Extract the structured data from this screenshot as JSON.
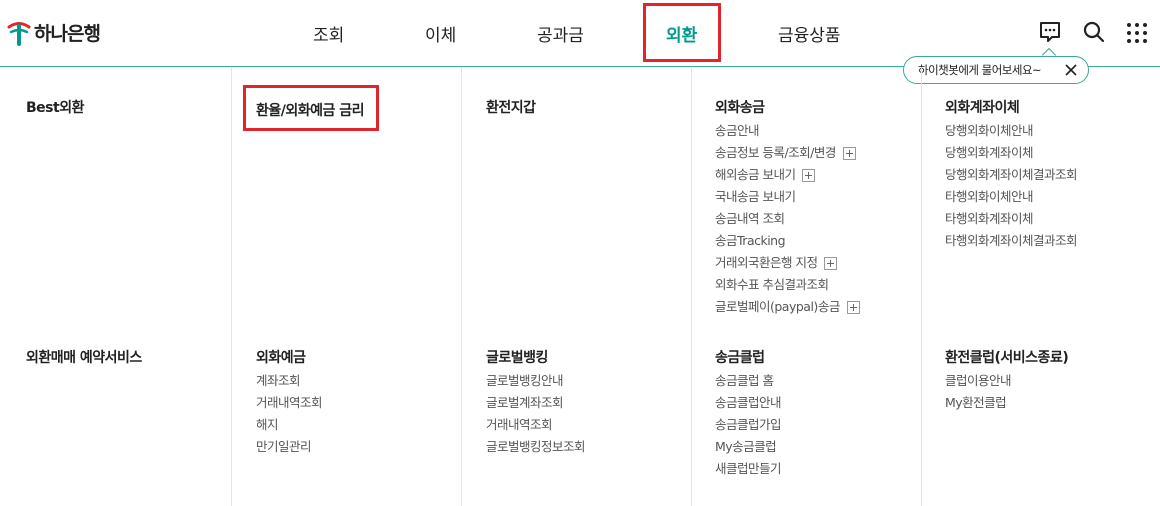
{
  "brand": {
    "name": "하나은행",
    "primary_color": "#009b8e",
    "highlight_color": "#e0262b"
  },
  "gnb": {
    "items": [
      {
        "label": "조회"
      },
      {
        "label": "이체"
      },
      {
        "label": "공과금"
      },
      {
        "label": "외환",
        "active": true
      },
      {
        "label": "금융상품"
      }
    ]
  },
  "utility": {
    "chatbot_icon": "chat-bubble-icon",
    "search_icon": "search-icon",
    "menu_icon": "grid-menu-icon"
  },
  "tooltip": {
    "text": "하이챗봇에게 물어보세요~",
    "close_icon": "close-icon"
  },
  "menu": {
    "row1": [
      {
        "title": "Best외환",
        "items": []
      },
      {
        "title": "환율/외화예금 금리",
        "items": []
      },
      {
        "title": "환전지갑",
        "items": []
      },
      {
        "title": "외화송금",
        "items": [
          {
            "label": "송금안내"
          },
          {
            "label": "송금정보 등록/조회/변경",
            "expand": true
          },
          {
            "label": "해외송금 보내기",
            "expand": true
          },
          {
            "label": "국내송금 보내기"
          },
          {
            "label": "송금내역 조회"
          },
          {
            "label": "송금Tracking"
          },
          {
            "label": "거래외국환은행 지정",
            "expand": true
          },
          {
            "label": "외화수표 추심결과조회"
          },
          {
            "label": "글로벌페이(paypal)송금",
            "expand": true
          }
        ]
      },
      {
        "title": "외화계좌이체",
        "items": [
          {
            "label": "당행외화이체안내"
          },
          {
            "label": "당행외화계좌이체"
          },
          {
            "label": "당행외화계좌이체결과조회"
          },
          {
            "label": "타행외화이체안내"
          },
          {
            "label": "타행외화계좌이체"
          },
          {
            "label": "타행외화계좌이체결과조회"
          }
        ]
      }
    ],
    "row2": [
      {
        "title": "외환매매 예약서비스",
        "items": []
      },
      {
        "title": "외화예금",
        "items": [
          {
            "label": "계좌조회"
          },
          {
            "label": "거래내역조회"
          },
          {
            "label": "해지"
          },
          {
            "label": "만기일관리"
          }
        ]
      },
      {
        "title": "글로벌뱅킹",
        "items": [
          {
            "label": "글로벌뱅킹안내"
          },
          {
            "label": "글로벌계좌조회"
          },
          {
            "label": "거래내역조회"
          },
          {
            "label": "글로벌뱅킹정보조회"
          }
        ]
      },
      {
        "title": "송금클럽",
        "items": [
          {
            "label": "송금클럽 홈"
          },
          {
            "label": "송금클럽안내"
          },
          {
            "label": "송금클럽가입"
          },
          {
            "label": "My송금클럽"
          },
          {
            "label": "새클럽만들기"
          }
        ]
      },
      {
        "title": "환전클럽(서비스종료)",
        "items": [
          {
            "label": "클럽이용안내"
          },
          {
            "label": "My환전클럽"
          }
        ]
      }
    ]
  }
}
